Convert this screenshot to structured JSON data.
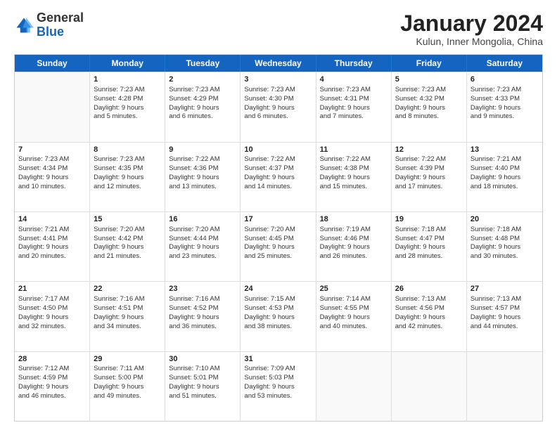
{
  "logo": {
    "general": "General",
    "blue": "Blue"
  },
  "header": {
    "title": "January 2024",
    "subtitle": "Kulun, Inner Mongolia, China"
  },
  "weekdays": [
    "Sunday",
    "Monday",
    "Tuesday",
    "Wednesday",
    "Thursday",
    "Friday",
    "Saturday"
  ],
  "rows": [
    [
      {
        "day": "",
        "empty": true
      },
      {
        "day": "1",
        "lines": [
          "Sunrise: 7:23 AM",
          "Sunset: 4:28 PM",
          "Daylight: 9 hours",
          "and 5 minutes."
        ]
      },
      {
        "day": "2",
        "lines": [
          "Sunrise: 7:23 AM",
          "Sunset: 4:29 PM",
          "Daylight: 9 hours",
          "and 6 minutes."
        ]
      },
      {
        "day": "3",
        "lines": [
          "Sunrise: 7:23 AM",
          "Sunset: 4:30 PM",
          "Daylight: 9 hours",
          "and 6 minutes."
        ]
      },
      {
        "day": "4",
        "lines": [
          "Sunrise: 7:23 AM",
          "Sunset: 4:31 PM",
          "Daylight: 9 hours",
          "and 7 minutes."
        ]
      },
      {
        "day": "5",
        "lines": [
          "Sunrise: 7:23 AM",
          "Sunset: 4:32 PM",
          "Daylight: 9 hours",
          "and 8 minutes."
        ]
      },
      {
        "day": "6",
        "lines": [
          "Sunrise: 7:23 AM",
          "Sunset: 4:33 PM",
          "Daylight: 9 hours",
          "and 9 minutes."
        ]
      }
    ],
    [
      {
        "day": "7",
        "lines": [
          "Sunrise: 7:23 AM",
          "Sunset: 4:34 PM",
          "Daylight: 9 hours",
          "and 10 minutes."
        ]
      },
      {
        "day": "8",
        "lines": [
          "Sunrise: 7:23 AM",
          "Sunset: 4:35 PM",
          "Daylight: 9 hours",
          "and 12 minutes."
        ]
      },
      {
        "day": "9",
        "lines": [
          "Sunrise: 7:22 AM",
          "Sunset: 4:36 PM",
          "Daylight: 9 hours",
          "and 13 minutes."
        ]
      },
      {
        "day": "10",
        "lines": [
          "Sunrise: 7:22 AM",
          "Sunset: 4:37 PM",
          "Daylight: 9 hours",
          "and 14 minutes."
        ]
      },
      {
        "day": "11",
        "lines": [
          "Sunrise: 7:22 AM",
          "Sunset: 4:38 PM",
          "Daylight: 9 hours",
          "and 15 minutes."
        ]
      },
      {
        "day": "12",
        "lines": [
          "Sunrise: 7:22 AM",
          "Sunset: 4:39 PM",
          "Daylight: 9 hours",
          "and 17 minutes."
        ]
      },
      {
        "day": "13",
        "lines": [
          "Sunrise: 7:21 AM",
          "Sunset: 4:40 PM",
          "Daylight: 9 hours",
          "and 18 minutes."
        ]
      }
    ],
    [
      {
        "day": "14",
        "lines": [
          "Sunrise: 7:21 AM",
          "Sunset: 4:41 PM",
          "Daylight: 9 hours",
          "and 20 minutes."
        ]
      },
      {
        "day": "15",
        "lines": [
          "Sunrise: 7:20 AM",
          "Sunset: 4:42 PM",
          "Daylight: 9 hours",
          "and 21 minutes."
        ]
      },
      {
        "day": "16",
        "lines": [
          "Sunrise: 7:20 AM",
          "Sunset: 4:44 PM",
          "Daylight: 9 hours",
          "and 23 minutes."
        ]
      },
      {
        "day": "17",
        "lines": [
          "Sunrise: 7:20 AM",
          "Sunset: 4:45 PM",
          "Daylight: 9 hours",
          "and 25 minutes."
        ]
      },
      {
        "day": "18",
        "lines": [
          "Sunrise: 7:19 AM",
          "Sunset: 4:46 PM",
          "Daylight: 9 hours",
          "and 26 minutes."
        ]
      },
      {
        "day": "19",
        "lines": [
          "Sunrise: 7:18 AM",
          "Sunset: 4:47 PM",
          "Daylight: 9 hours",
          "and 28 minutes."
        ]
      },
      {
        "day": "20",
        "lines": [
          "Sunrise: 7:18 AM",
          "Sunset: 4:48 PM",
          "Daylight: 9 hours",
          "and 30 minutes."
        ]
      }
    ],
    [
      {
        "day": "21",
        "lines": [
          "Sunrise: 7:17 AM",
          "Sunset: 4:50 PM",
          "Daylight: 9 hours",
          "and 32 minutes."
        ]
      },
      {
        "day": "22",
        "lines": [
          "Sunrise: 7:16 AM",
          "Sunset: 4:51 PM",
          "Daylight: 9 hours",
          "and 34 minutes."
        ]
      },
      {
        "day": "23",
        "lines": [
          "Sunrise: 7:16 AM",
          "Sunset: 4:52 PM",
          "Daylight: 9 hours",
          "and 36 minutes."
        ]
      },
      {
        "day": "24",
        "lines": [
          "Sunrise: 7:15 AM",
          "Sunset: 4:53 PM",
          "Daylight: 9 hours",
          "and 38 minutes."
        ]
      },
      {
        "day": "25",
        "lines": [
          "Sunrise: 7:14 AM",
          "Sunset: 4:55 PM",
          "Daylight: 9 hours",
          "and 40 minutes."
        ]
      },
      {
        "day": "26",
        "lines": [
          "Sunrise: 7:13 AM",
          "Sunset: 4:56 PM",
          "Daylight: 9 hours",
          "and 42 minutes."
        ]
      },
      {
        "day": "27",
        "lines": [
          "Sunrise: 7:13 AM",
          "Sunset: 4:57 PM",
          "Daylight: 9 hours",
          "and 44 minutes."
        ]
      }
    ],
    [
      {
        "day": "28",
        "lines": [
          "Sunrise: 7:12 AM",
          "Sunset: 4:59 PM",
          "Daylight: 9 hours",
          "and 46 minutes."
        ]
      },
      {
        "day": "29",
        "lines": [
          "Sunrise: 7:11 AM",
          "Sunset: 5:00 PM",
          "Daylight: 9 hours",
          "and 49 minutes."
        ]
      },
      {
        "day": "30",
        "lines": [
          "Sunrise: 7:10 AM",
          "Sunset: 5:01 PM",
          "Daylight: 9 hours",
          "and 51 minutes."
        ]
      },
      {
        "day": "31",
        "lines": [
          "Sunrise: 7:09 AM",
          "Sunset: 5:03 PM",
          "Daylight: 9 hours",
          "and 53 minutes."
        ]
      },
      {
        "day": "",
        "empty": true
      },
      {
        "day": "",
        "empty": true
      },
      {
        "day": "",
        "empty": true
      }
    ]
  ]
}
